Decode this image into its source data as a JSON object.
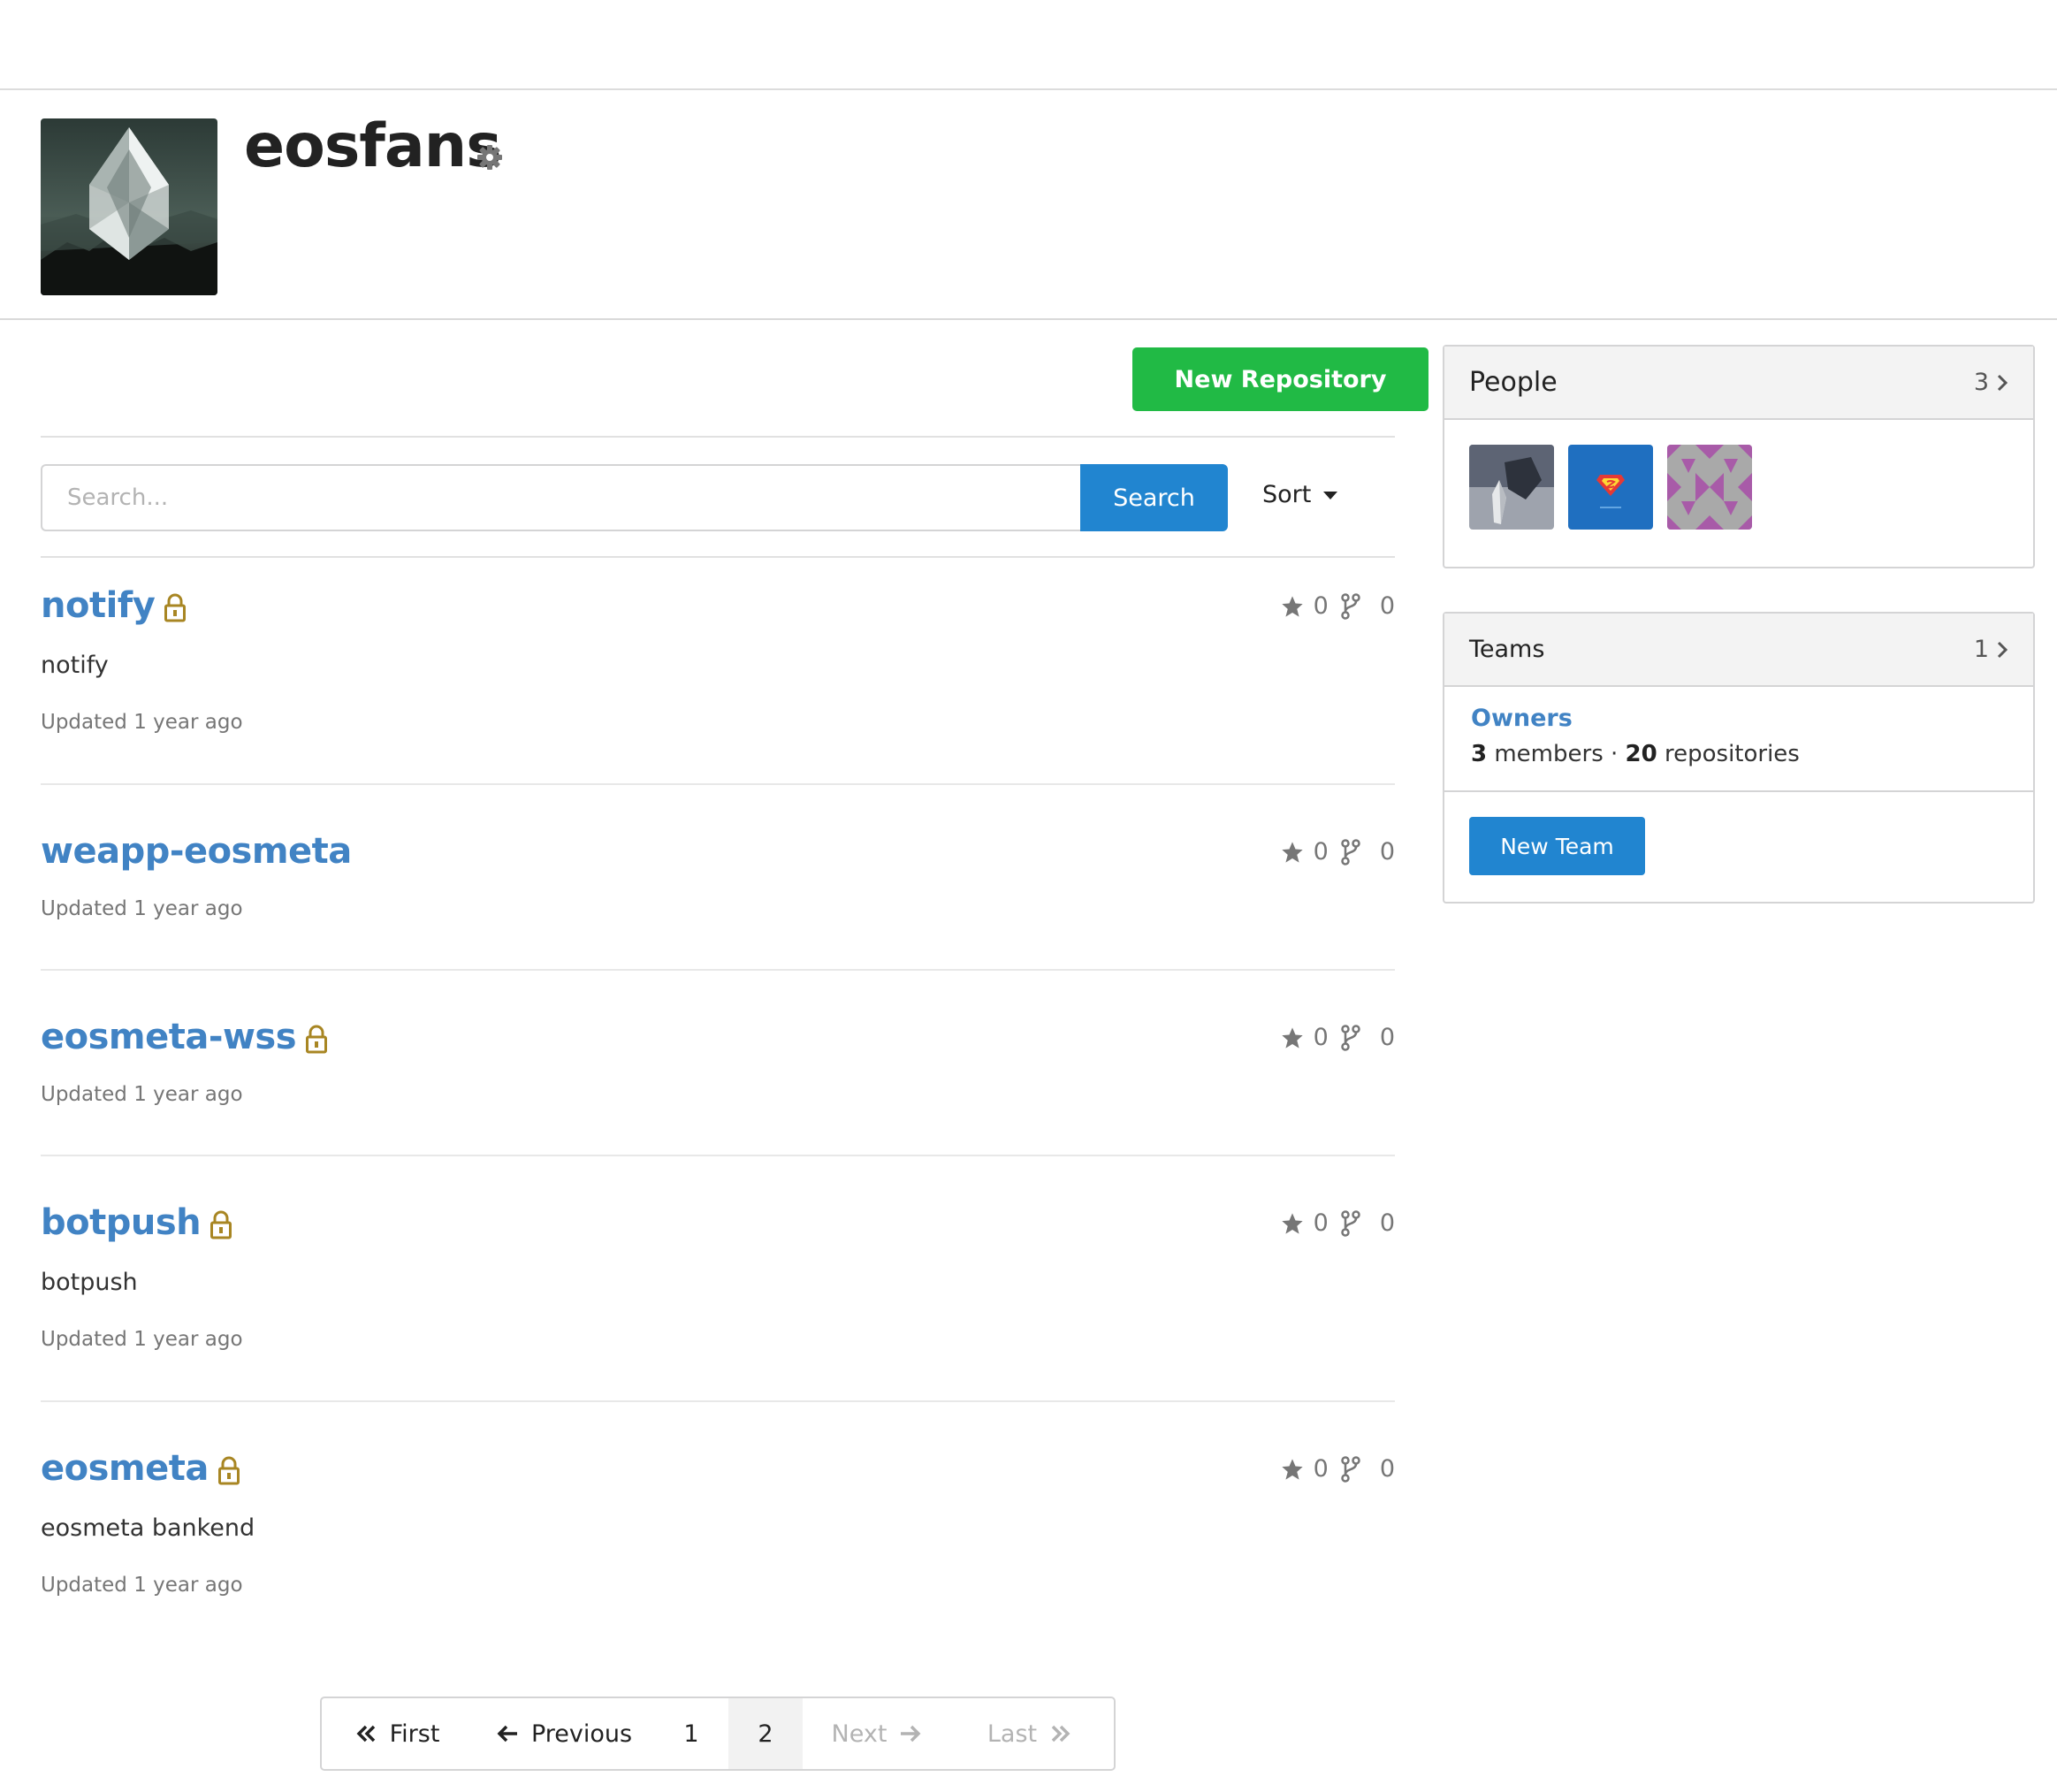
{
  "org": {
    "name": "eosfans",
    "avatar_icon": "eos-logo",
    "settings_icon": "gear-icon"
  },
  "actions": {
    "new_repository_label": "New Repository"
  },
  "search": {
    "placeholder": "Search...",
    "button_label": "Search",
    "sort_label": "Sort"
  },
  "repos": [
    {
      "name": "notify",
      "private": true,
      "description": "notify",
      "updated": "Updated 1 year ago",
      "stars": "0",
      "forks": "0"
    },
    {
      "name": "weapp-eosmeta",
      "private": false,
      "description": "",
      "updated": "Updated 1 year ago",
      "stars": "0",
      "forks": "0"
    },
    {
      "name": "eosmeta-wss",
      "private": true,
      "description": "",
      "updated": "Updated 1 year ago",
      "stars": "0",
      "forks": "0"
    },
    {
      "name": "botpush",
      "private": true,
      "description": "botpush",
      "updated": "Updated 1 year ago",
      "stars": "0",
      "forks": "0"
    },
    {
      "name": "eosmeta",
      "private": true,
      "description": "eosmeta bankend",
      "updated": "Updated 1 year ago",
      "stars": "0",
      "forks": "0"
    }
  ],
  "pagination": {
    "first": "First",
    "previous": "Previous",
    "page1": "1",
    "page2": "2",
    "next": "Next",
    "last": "Last",
    "current_page": 2
  },
  "people": {
    "title": "People",
    "count": "3"
  },
  "teams": {
    "title": "Teams",
    "count": "1",
    "team_name": "Owners",
    "members_count": "3",
    "members_label": " members · ",
    "repos_count": "20",
    "repos_label": " repositories",
    "new_team_label": "New Team"
  },
  "colors": {
    "link": "#4183c4",
    "primary": "#2185d0",
    "green": "#21ba45",
    "lock": "#a88623"
  }
}
